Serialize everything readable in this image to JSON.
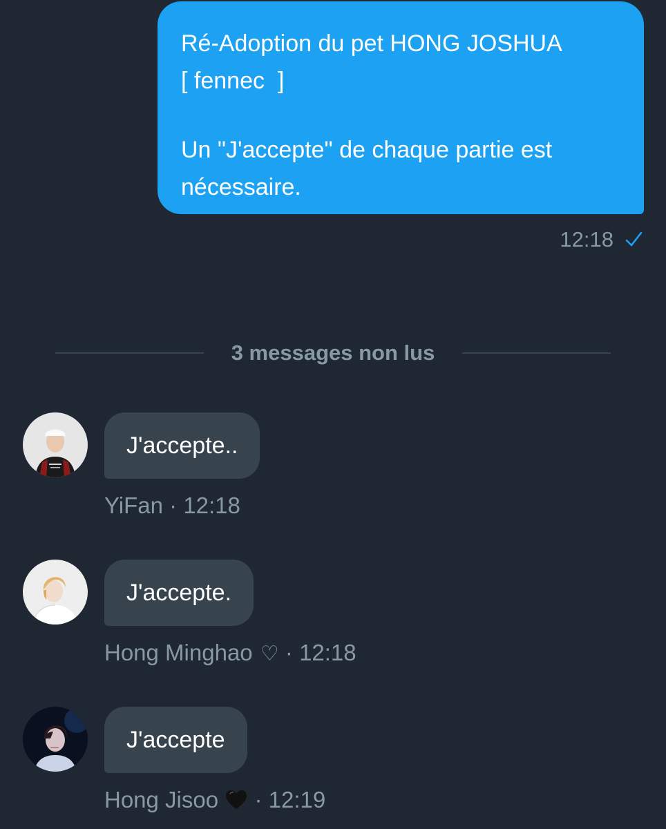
{
  "sent_message": {
    "lines": [
      "Ré-Adoption du pet HONG JOSHUA",
      "[ fennec  ]",
      "",
      "Un \"J'accepte\" de chaque partie est",
      "nécessaire."
    ],
    "time": "12:18"
  },
  "divider_label": "3 messages non lus",
  "messages": [
    {
      "text": "J'accepte..",
      "sender": "YiFan",
      "separator": " · ",
      "time": "12:18",
      "heart": ""
    },
    {
      "text": "J'accepte.",
      "sender": "Hong Minghao",
      "separator": " · ",
      "time": "12:18",
      "heart": "♡"
    },
    {
      "text": "J'accepte",
      "sender": "Hong Jisoo",
      "separator": " · ",
      "time": "12:19",
      "heart": "black-heart"
    }
  ],
  "colors": {
    "background": "#1e2732",
    "sent_bubble": "#1da1f2",
    "received_bubble": "#38444d",
    "muted_text": "#8899a6",
    "check": "#1da1f2"
  }
}
